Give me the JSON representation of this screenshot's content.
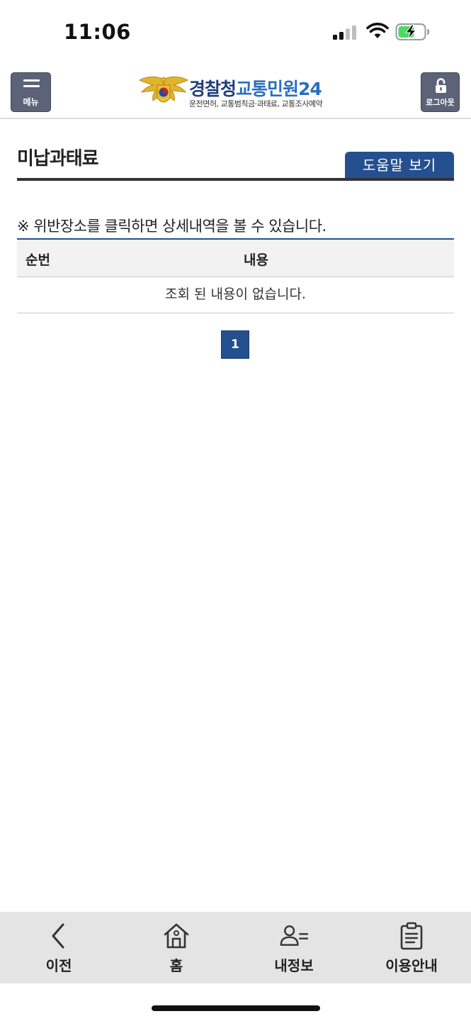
{
  "status_bar": {
    "time": "11:06"
  },
  "header": {
    "menu_label": "메뉴",
    "logo_title_part1": "경찰청",
    "logo_title_part2": "교통민원24",
    "logo_subtitle": "운전면허, 교통범칙금·과태료, 교통조사예약",
    "logout_label": "로그아웃"
  },
  "page": {
    "title": "미납과태료",
    "help_button": "도움말 보기",
    "notice": "※ 위반장소를 클릭하면 상세내역을 볼 수 있습니다."
  },
  "table": {
    "columns": [
      "순번",
      "내용"
    ],
    "empty_message": "조회 된 내용이 없습니다."
  },
  "pagination": {
    "current_page": "1"
  },
  "bottom_nav": {
    "items": [
      {
        "label": "이전",
        "icon": "back-chevron-icon"
      },
      {
        "label": "홈",
        "icon": "home-icon"
      },
      {
        "label": "내정보",
        "icon": "user-info-icon"
      },
      {
        "label": "이용안내",
        "icon": "clipboard-icon"
      }
    ]
  },
  "colors": {
    "primary": "#24508f",
    "header_button": "#5c6378",
    "nav_background": "#e4e4e4",
    "battery_green": "#4cd964"
  }
}
